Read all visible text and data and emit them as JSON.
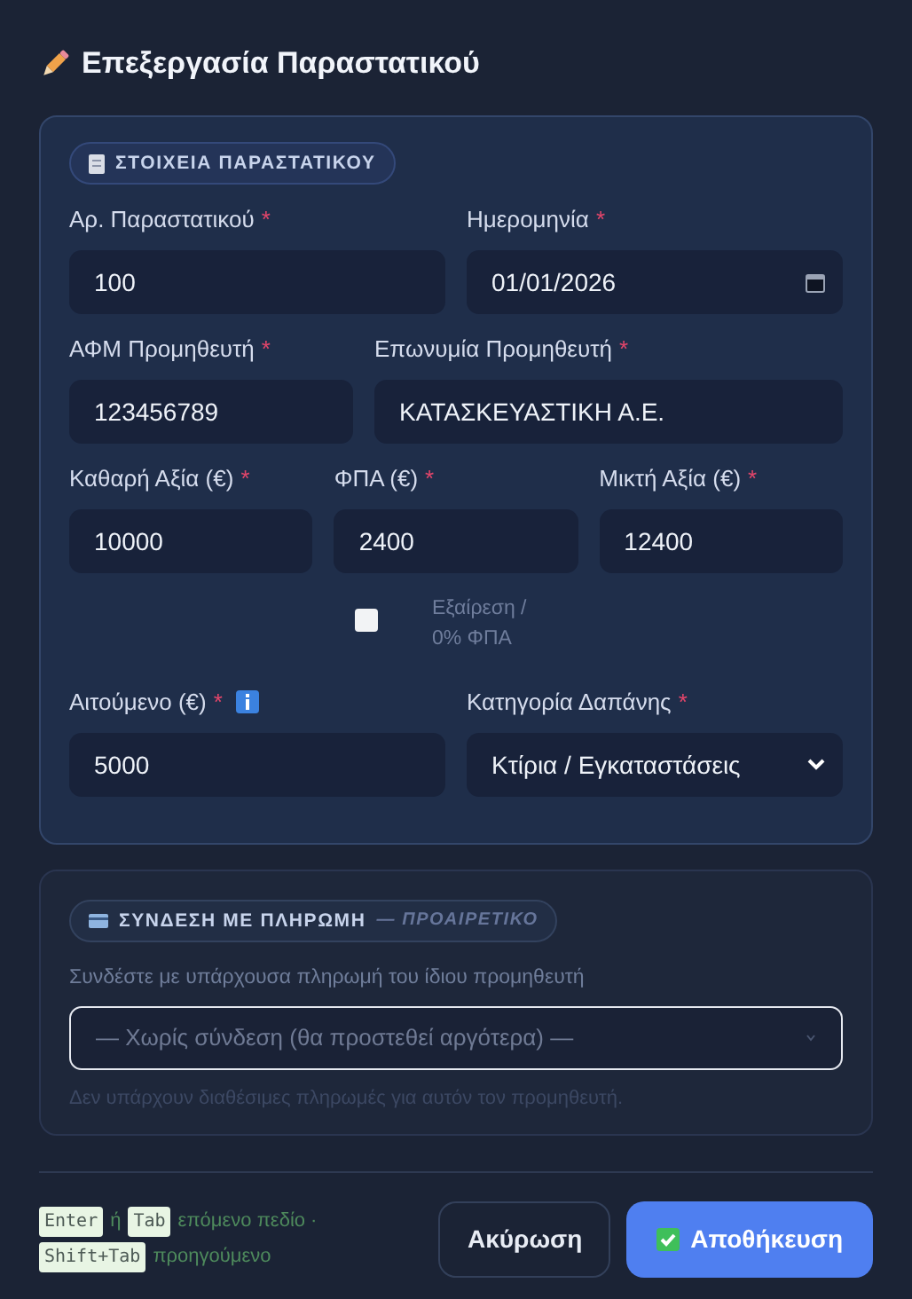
{
  "title": "Επεξεργασία Παραστατικού",
  "details": {
    "badge": "ΣΤΟΙΧΕΙΑ ΠΑΡΑΣΤΑΤΙΚΟΥ",
    "rows": [
      {
        "kind": "pair",
        "fields": [
          {
            "label": "Αρ. Παραστατικού",
            "mark": "*",
            "kind": "text",
            "value": "100"
          },
          {
            "label": "Ημερομηνία",
            "mark": "*",
            "kind": "date",
            "value": "01/01/2026"
          }
        ]
      },
      {
        "kind": "id-name",
        "fields": [
          {
            "label": "ΑΦΜ Προμηθευτή",
            "mark": "*",
            "kind": "text",
            "value": "123456789"
          },
          {
            "label": "Επωνυμία Προμηθευτή",
            "mark": "*",
            "kind": "text",
            "value": "ΚΑΤΑΣΚΕΥΑΣΤΙΚΗ Α.Ε."
          }
        ]
      },
      {
        "kind": "triple",
        "fields": [
          {
            "label": "Καθαρή Αξία (€)",
            "mark": "*",
            "kind": "text",
            "value": "10000"
          },
          {
            "label": "ΦΠΑ (€)",
            "mark": "*",
            "kind": "text",
            "value": "2400"
          },
          {
            "label": "Μικτή Αξία (€)",
            "mark": "*",
            "kind": "text",
            "value": "12400"
          }
        ]
      },
      {
        "kind": "check",
        "fields": [
          {
            "label": "Εξαίρεση / 0% ΦΠΑ",
            "kind": "checkbox",
            "checked": false
          }
        ]
      },
      {
        "kind": "pair",
        "fields": [
          {
            "label": "Αιτούμενο (€)",
            "mark": "*",
            "info": true,
            "kind": "text",
            "value": "5000"
          },
          {
            "label": "Κατηγορία Δαπάνης",
            "mark": "*",
            "kind": "select",
            "value": "Κτίρια / Εγκαταστάσεις"
          }
        ]
      }
    ]
  },
  "payment": {
    "badge": "ΣΥΝΔΕΣΗ ΜΕ ΠΛΗΡΩΜΗ",
    "badge_note": "— ΠΡΟΑΙΡΕΤΙΚΟ",
    "description": "Συνδέστε με υπάρχουσα πληρωμή του ίδιου προμηθευτή",
    "select": {
      "value": "— Χωρίς σύνδεση (θα προστεθεί αργότερα) —",
      "disabled": true
    },
    "note": "Δεν υπάρχουν διαθέσιμες πληρωμές για αυτόν τον προμηθευτή."
  },
  "hint": [
    {
      "kind": "key",
      "text": "Enter"
    },
    {
      "kind": "text",
      "text": "ή"
    },
    {
      "kind": "key",
      "text": "Tab"
    },
    {
      "kind": "text",
      "text": "επόμενο πεδίο ·"
    },
    {
      "kind": "key",
      "text": "Shift+Tab"
    },
    {
      "kind": "text",
      "text": "προηγούμενο"
    }
  ],
  "buttons": [
    {
      "kind": "secondary",
      "label": "Ακύρωση"
    },
    {
      "kind": "primary",
      "label": "Αποθήκευση"
    }
  ]
}
